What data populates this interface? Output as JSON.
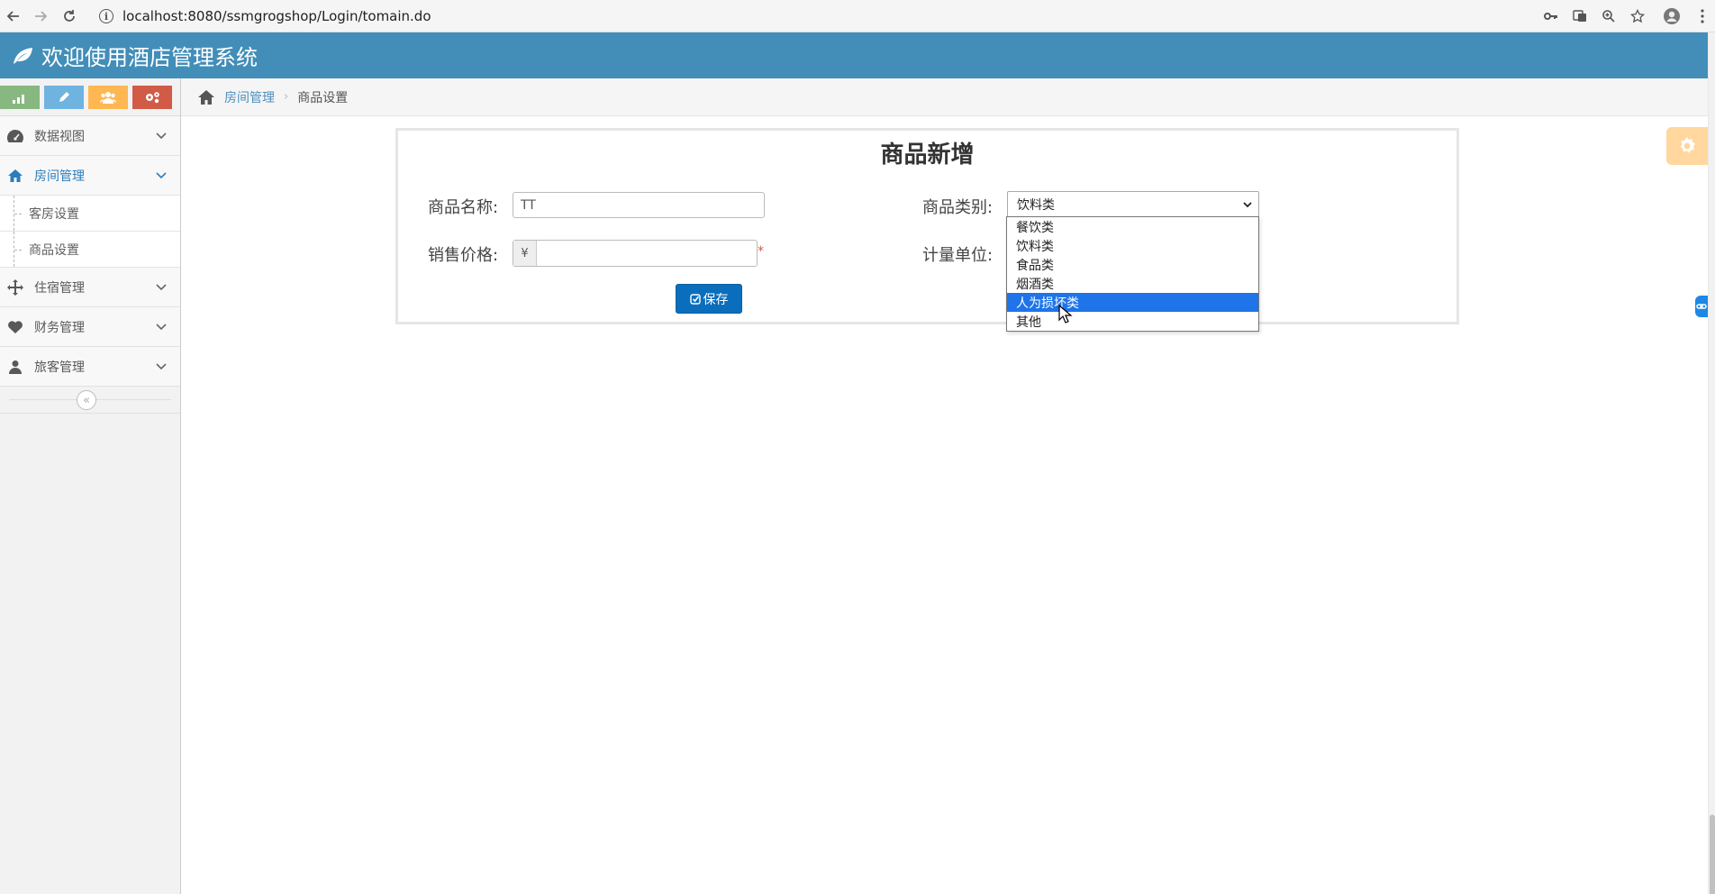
{
  "browser": {
    "url": "localhost:8080/ssmgrogshop/Login/tomain.do"
  },
  "header": {
    "title": "欢迎使用酒店管理系统"
  },
  "sidebar": {
    "items": [
      {
        "label": "数据视图"
      },
      {
        "label": "房间管理",
        "active": true,
        "children": [
          {
            "label": "客房设置"
          },
          {
            "label": "商品设置"
          }
        ]
      },
      {
        "label": "住宿管理"
      },
      {
        "label": "财务管理"
      },
      {
        "label": "旅客管理"
      }
    ],
    "shortcut_colors": [
      "#87b87f",
      "#6fb3e0",
      "#ffb752",
      "#d15b47"
    ]
  },
  "breadcrumb": {
    "parent": "房间管理",
    "sep": "›",
    "current": "商品设置"
  },
  "form": {
    "title": "商品新增",
    "name_label": "商品名称:",
    "name_value": "TT",
    "category_label": "商品类别:",
    "category_value": "饮料类",
    "price_label": "销售价格:",
    "price_addon": "¥",
    "price_value": "",
    "required_mark": "*",
    "unit_label": "计量单位:",
    "save_label": "保存"
  },
  "dropdown": {
    "options": [
      "餐饮类",
      "饮料类",
      "食品类",
      "烟酒类",
      "人为损坏类",
      "其他"
    ],
    "highlighted": "人为损坏类"
  },
  "colors": {
    "header": "#438eb9",
    "accent": "#2b7dbc",
    "save_button": "#0a6ebd",
    "highlight": "#1e74e8"
  }
}
